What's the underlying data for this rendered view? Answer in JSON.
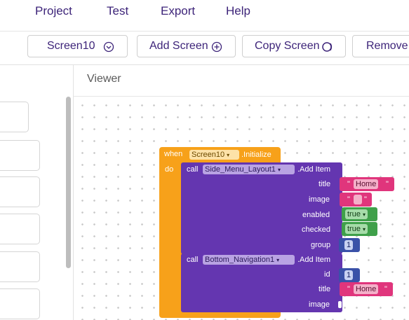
{
  "menu": {
    "items": [
      "Project",
      "Test",
      "Export",
      "Help"
    ]
  },
  "toolbar": {
    "screen_select": "Screen10",
    "add_screen": "Add Screen",
    "copy_screen": "Copy Screen",
    "remove_screen": "Remove S"
  },
  "viewer": {
    "title": "Viewer"
  },
  "blocks": {
    "event": {
      "when": "when",
      "component": "Screen10",
      "event_name": ".Initialize",
      "do": "do"
    },
    "call1": {
      "call": "call",
      "component": "Side_Menu_Layout1",
      "method": ".Add Item",
      "params": {
        "title_label": "title",
        "title_value": "Home",
        "image_label": "image",
        "image_value": "",
        "enabled_label": "enabled",
        "enabled_value": "true",
        "checked_label": "checked",
        "checked_value": "true",
        "group_label": "group",
        "group_value": "1"
      }
    },
    "call2": {
      "call": "call",
      "component": "Bottom_Navigation1",
      "method": ".Add Item",
      "params": {
        "id_label": "id",
        "id_value": "1",
        "title_label": "title",
        "title_value": "Home",
        "image_label": "image"
      }
    }
  },
  "quote_mark": "\"",
  "colors": {
    "event_block": "#f7a11a",
    "method_block": "#6436b0",
    "text_block": "#e0357c",
    "logic_block": "#3fa04a",
    "math_block": "#3a51a8",
    "brand_text": "#3d2479"
  }
}
